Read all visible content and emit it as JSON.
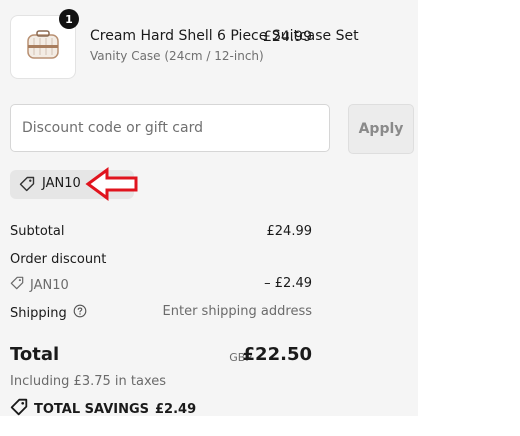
{
  "cart": {
    "quantity": "1",
    "product_name": "Cream Hard Shell 6 Piece Suitcase Set",
    "variant": "Vanity Case (24cm / 12-inch)",
    "price": "£24.99"
  },
  "discount": {
    "placeholder": "Discount code or gift card",
    "apply_label": "Apply",
    "applied_code": "JAN10"
  },
  "summary": {
    "subtotal_label": "Subtotal",
    "subtotal_value": "£24.99",
    "order_discount_label": "Order discount",
    "discount_code": "JAN10",
    "discount_value": "– £2.49",
    "shipping_label": "Shipping",
    "shipping_value": "Enter shipping address",
    "total_label": "Total",
    "currency": "GBP",
    "total_value": "£22.50",
    "taxes_note": "Including £3.75 in taxes",
    "total_savings_label": "TOTAL SAVINGS",
    "total_savings_value": "£2.49"
  },
  "colors": {
    "panel_background": "#f5f5f5",
    "arrow_annotation": "#e0141e"
  }
}
